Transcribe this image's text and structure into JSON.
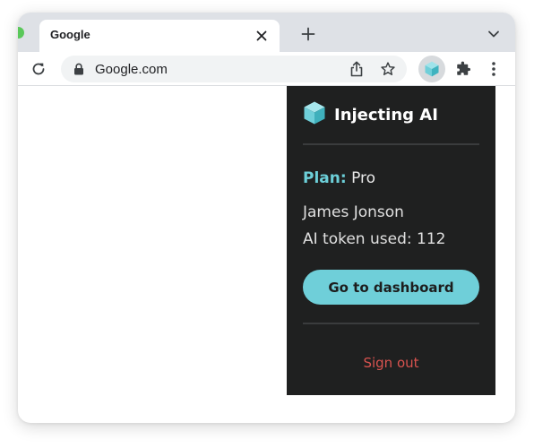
{
  "browser": {
    "tab_title": "Google",
    "url": "Google.com",
    "icons": {
      "tab_close": "close-icon",
      "new_tab": "plus-icon",
      "tab_menu": "chevron-down-icon",
      "reload": "reload-icon",
      "lock": "lock-icon",
      "share": "share-icon",
      "bookmark": "star-icon",
      "extension": "cube-icon",
      "extensions_menu": "puzzle-icon",
      "menu": "kebab-menu-icon"
    }
  },
  "popup": {
    "brand_name": "Injecting AI",
    "plan_label": "Plan:",
    "plan_value": "Pro",
    "user_name": "James Jonson",
    "token_usage": "AI token used: 112",
    "dashboard_button": "Go to dashboard",
    "sign_out": "Sign out"
  },
  "colors": {
    "accent": "#6fcfd9",
    "popup_background": "#1f2020",
    "sign_out": "#d9534f",
    "window_dot": "#5ac85a"
  }
}
